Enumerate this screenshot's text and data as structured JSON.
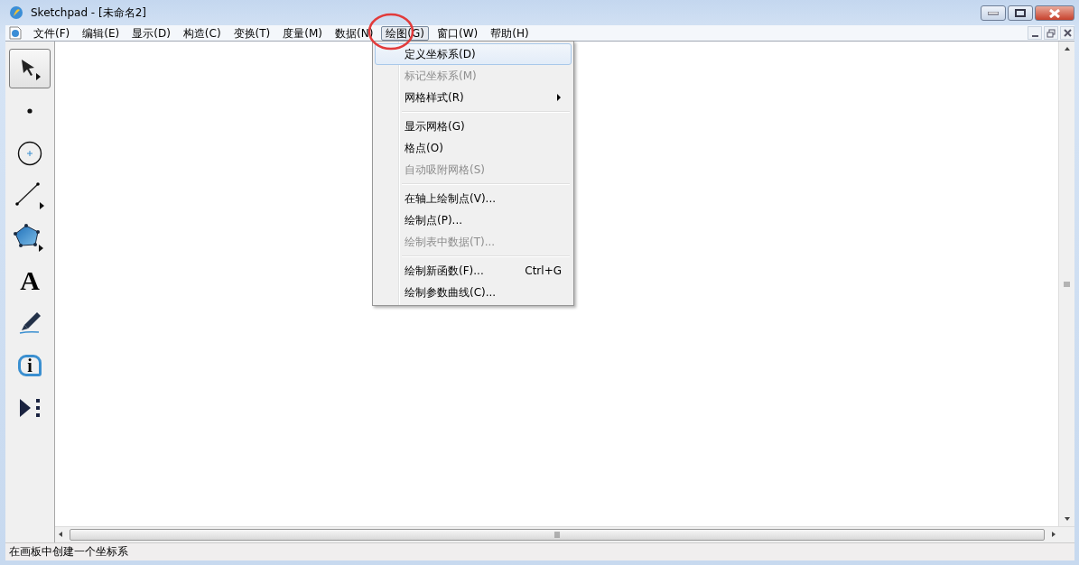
{
  "window": {
    "title": "Sketchpad  - [未命名2]"
  },
  "menubar": [
    {
      "label": "文件(F)",
      "selected": false
    },
    {
      "label": "编辑(E)",
      "selected": false
    },
    {
      "label": "显示(D)",
      "selected": false
    },
    {
      "label": "构造(C)",
      "selected": false
    },
    {
      "label": "变换(T)",
      "selected": false
    },
    {
      "label": "度量(M)",
      "selected": false
    },
    {
      "label": "数据(N)",
      "selected": false
    },
    {
      "label": "绘图(G)",
      "selected": true
    },
    {
      "label": "窗口(W)",
      "selected": false
    },
    {
      "label": "帮助(H)",
      "selected": false
    }
  ],
  "menu": {
    "groups": [
      [
        {
          "label": "定义坐标系(D)",
          "disabled": false,
          "selected": true
        },
        {
          "label": "标记坐标系(M)",
          "disabled": true,
          "selected": false
        },
        {
          "label": "网格样式(R)",
          "disabled": false,
          "selected": false,
          "submenu": true
        }
      ],
      [
        {
          "label": "显示网格(G)",
          "disabled": false,
          "selected": false
        },
        {
          "label": "格点(O)",
          "disabled": false,
          "selected": false
        },
        {
          "label": "自动吸附网格(S)",
          "disabled": true,
          "selected": false
        }
      ],
      [
        {
          "label": "在轴上绘制点(V)...",
          "disabled": false,
          "selected": false
        },
        {
          "label": "绘制点(P)...",
          "disabled": false,
          "selected": false
        },
        {
          "label": "绘制表中数据(T)...",
          "disabled": true,
          "selected": false
        }
      ],
      [
        {
          "label": "绘制新函数(F)...",
          "disabled": false,
          "selected": false,
          "shortcut": "Ctrl+G"
        },
        {
          "label": "绘制参数曲线(C)...",
          "disabled": false,
          "selected": false
        }
      ]
    ]
  },
  "tools": [
    {
      "kind": "arrow",
      "selected": true
    },
    {
      "kind": "point",
      "selected": false
    },
    {
      "kind": "compass",
      "selected": false
    },
    {
      "kind": "line",
      "selected": false
    },
    {
      "kind": "polygon",
      "selected": false
    },
    {
      "kind": "text",
      "glyph": "A",
      "selected": false
    },
    {
      "kind": "marker",
      "selected": false
    },
    {
      "kind": "info",
      "glyph": "i",
      "selected": false
    },
    {
      "kind": "custom",
      "selected": false
    }
  ],
  "status_bar": "在画板中创建一个坐标系"
}
